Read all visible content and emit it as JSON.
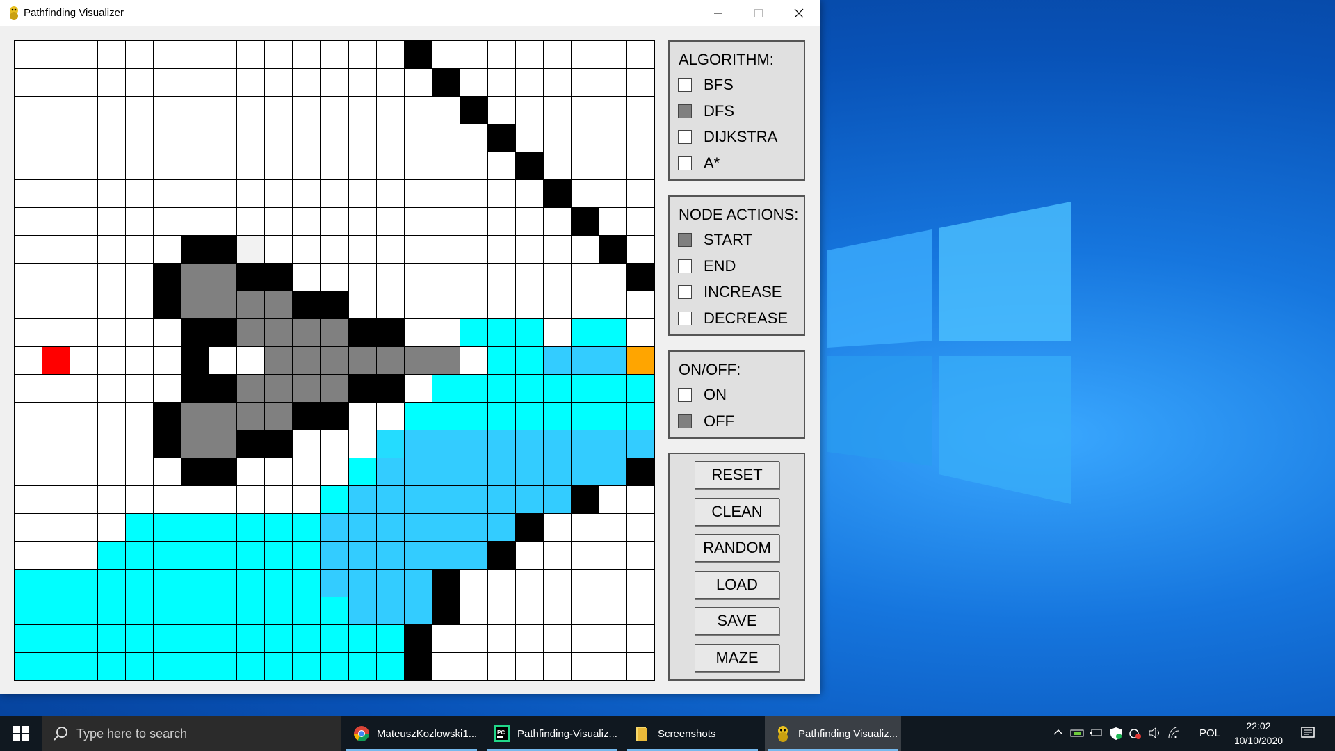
{
  "window": {
    "title": "Pathfinding Visualizer"
  },
  "grid": {
    "cols": 23,
    "rows": [
      "..............W........",
      "...............W.......",
      "................W......",
      ".................W.....",
      "..................W....",
      "...................W...",
      "....................W..",
      "......WWg............W.",
      ".....WGGWW............W",
      ".....WGGGGWW...........",
      "......WWGGGGWW..CCC.CC",
      ".S....W..GGGGGGG.CCcccEc",
      "......WWGGGGWW.CCCCCCCCc",
      ".....WGGGGWW..CCCCCCCCCc",
      ".....WGGWW...bcccccccccW",
      "......WW....CcccccccccW.",
      "...........CccccccccW..",
      "....CCCCCCCcccccccW...",
      "...CCCCCCCCccccccW....",
      "CCCCCCCCCCCccccW......",
      "CCCCCCCCCCCCcccW.......",
      "CCCCCCCCCCCCCCW........",
      "CCCCCCCCCCCCCCW........"
    ]
  },
  "algorithm": {
    "title": "ALGORITHM:",
    "options": [
      {
        "label": "BFS",
        "checked": false
      },
      {
        "label": "DFS",
        "checked": true
      },
      {
        "label": "DIJKSTRA",
        "checked": false
      },
      {
        "label": "A*",
        "checked": false
      }
    ]
  },
  "node_actions": {
    "title": "NODE ACTIONS:",
    "options": [
      {
        "label": "START",
        "checked": true
      },
      {
        "label": "END",
        "checked": false
      },
      {
        "label": "INCREASE",
        "checked": false
      },
      {
        "label": "DECREASE",
        "checked": false
      }
    ]
  },
  "onoff": {
    "title": "ON/OFF:",
    "options": [
      {
        "label": "ON",
        "checked": false
      },
      {
        "label": "OFF",
        "checked": true
      }
    ]
  },
  "buttons": {
    "reset": "RESET",
    "clean": "CLEAN",
    "random": "RANDOM",
    "load": "LOAD",
    "save": "SAVE",
    "maze": "MAZE"
  },
  "taskbar": {
    "search_placeholder": "Type here to search",
    "tasks": [
      {
        "label": "MateuszKozlowski1...",
        "icon": "chrome-icon"
      },
      {
        "label": "Pathfinding-Visualiz...",
        "icon": "pycharm-icon"
      },
      {
        "label": "Screenshots",
        "icon": "folder-icon"
      },
      {
        "label": "Pathfinding Visualiz...",
        "icon": "python-snake-icon"
      }
    ],
    "language": "POL",
    "time": "22:02",
    "date": "10/10/2020"
  },
  "colors": {
    "wall": "#000000",
    "visited": "#808080",
    "start": "#ff0000",
    "end": "#ffa500",
    "cyan": "#00ffff",
    "blue": "#33ccff"
  }
}
